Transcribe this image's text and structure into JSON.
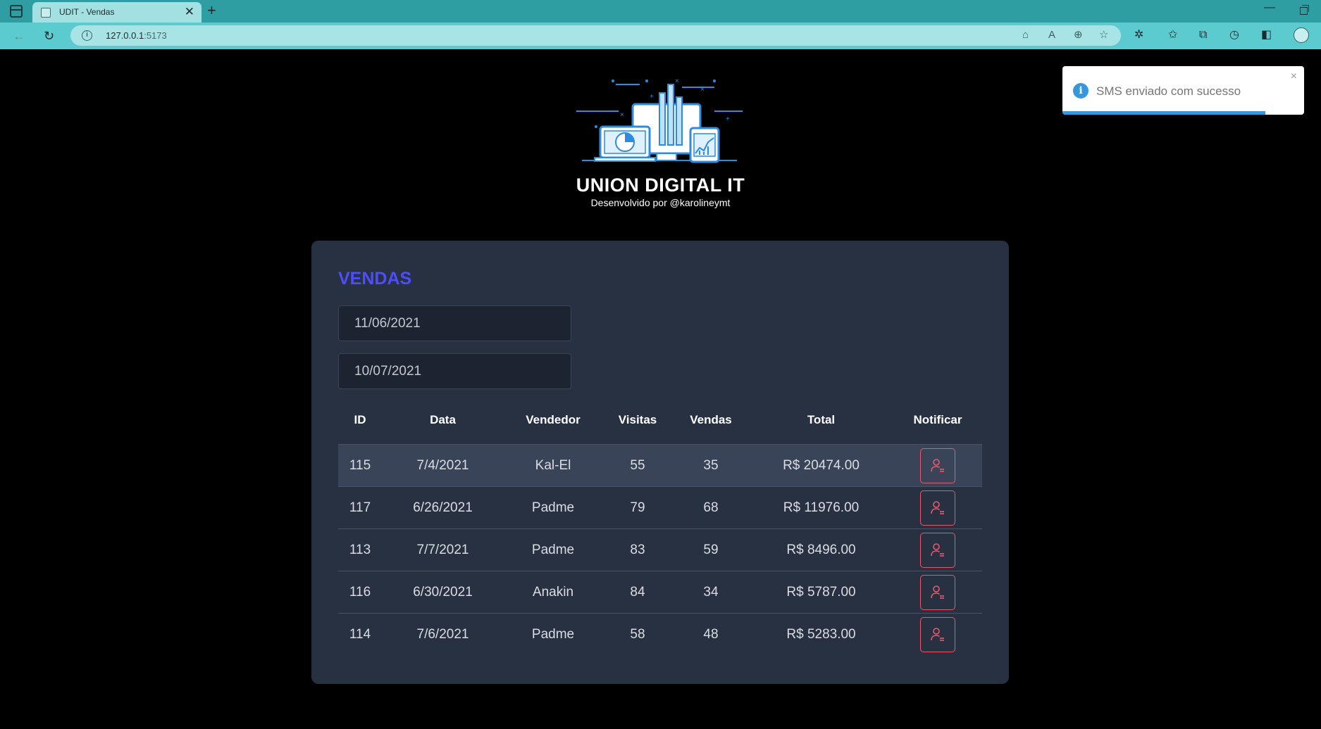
{
  "browser": {
    "tab_title": "UDIT - Vendas",
    "tab_close": "✕",
    "new_tab": "+",
    "url_host": "127.0.0.1",
    "url_port": ":5173",
    "minimize": "—"
  },
  "header": {
    "title": "UNION DIGITAL IT",
    "subtitle": "Desenvolvido por @karolineymt"
  },
  "sales": {
    "title": "VENDAS",
    "min_date": "11/06/2021",
    "max_date": "10/07/2021",
    "columns": [
      "ID",
      "Data",
      "Vendedor",
      "Visitas",
      "Vendas",
      "Total",
      "Notificar"
    ],
    "rows": [
      {
        "id": "115",
        "date": "7/4/2021",
        "seller": "Kal-El",
        "visits": "55",
        "deals": "35",
        "total": "R$ 20474.00"
      },
      {
        "id": "117",
        "date": "6/26/2021",
        "seller": "Padme",
        "visits": "79",
        "deals": "68",
        "total": "R$ 11976.00"
      },
      {
        "id": "113",
        "date": "7/7/2021",
        "seller": "Padme",
        "visits": "83",
        "deals": "59",
        "total": "R$ 8496.00"
      },
      {
        "id": "116",
        "date": "6/30/2021",
        "seller": "Anakin",
        "visits": "84",
        "deals": "34",
        "total": "R$ 5787.00"
      },
      {
        "id": "114",
        "date": "7/6/2021",
        "seller": "Padme",
        "visits": "58",
        "deals": "48",
        "total": "R$ 5283.00"
      }
    ]
  },
  "toast": {
    "message": "SMS enviado com sucesso",
    "icon": "info-icon",
    "close": "×",
    "progress": 0.84
  },
  "colors": {
    "accent": "#4d4dff",
    "notify": "#e8596d",
    "toast_info": "#3498db",
    "card_bg": "#283142"
  }
}
